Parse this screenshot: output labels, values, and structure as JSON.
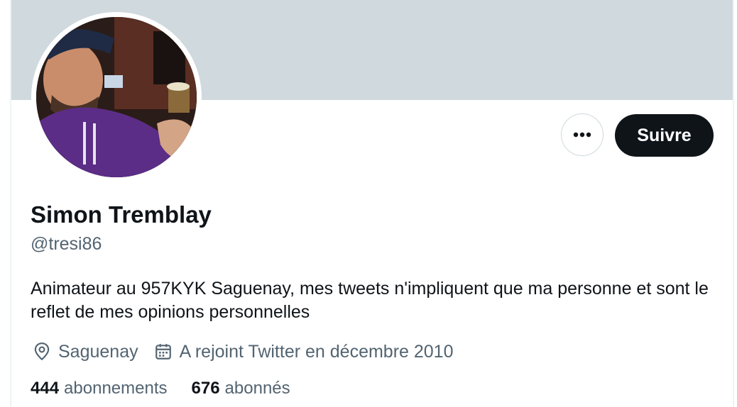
{
  "profile": {
    "display_name": "Simon Tremblay",
    "handle": "@tresi86",
    "bio": "Animateur au 957KYK Saguenay, mes tweets n'impliquent que ma personne et sont le reflet de mes opinions personnelles",
    "location": "Saguenay",
    "joined": "A rejoint Twitter en décembre 2010"
  },
  "actions": {
    "follow_label": "Suivre",
    "more_icon": "more-horizontal-icon"
  },
  "stats": {
    "following_count": "444",
    "following_label": "abonnements",
    "followers_count": "676",
    "followers_label": "abonnés"
  },
  "icons": {
    "location": "location-pin-icon",
    "calendar": "calendar-icon"
  },
  "colors": {
    "banner": "#cfd9de",
    "follow_button": "#0f1419",
    "secondary_text": "#536471",
    "primary_text": "#0f1419"
  }
}
